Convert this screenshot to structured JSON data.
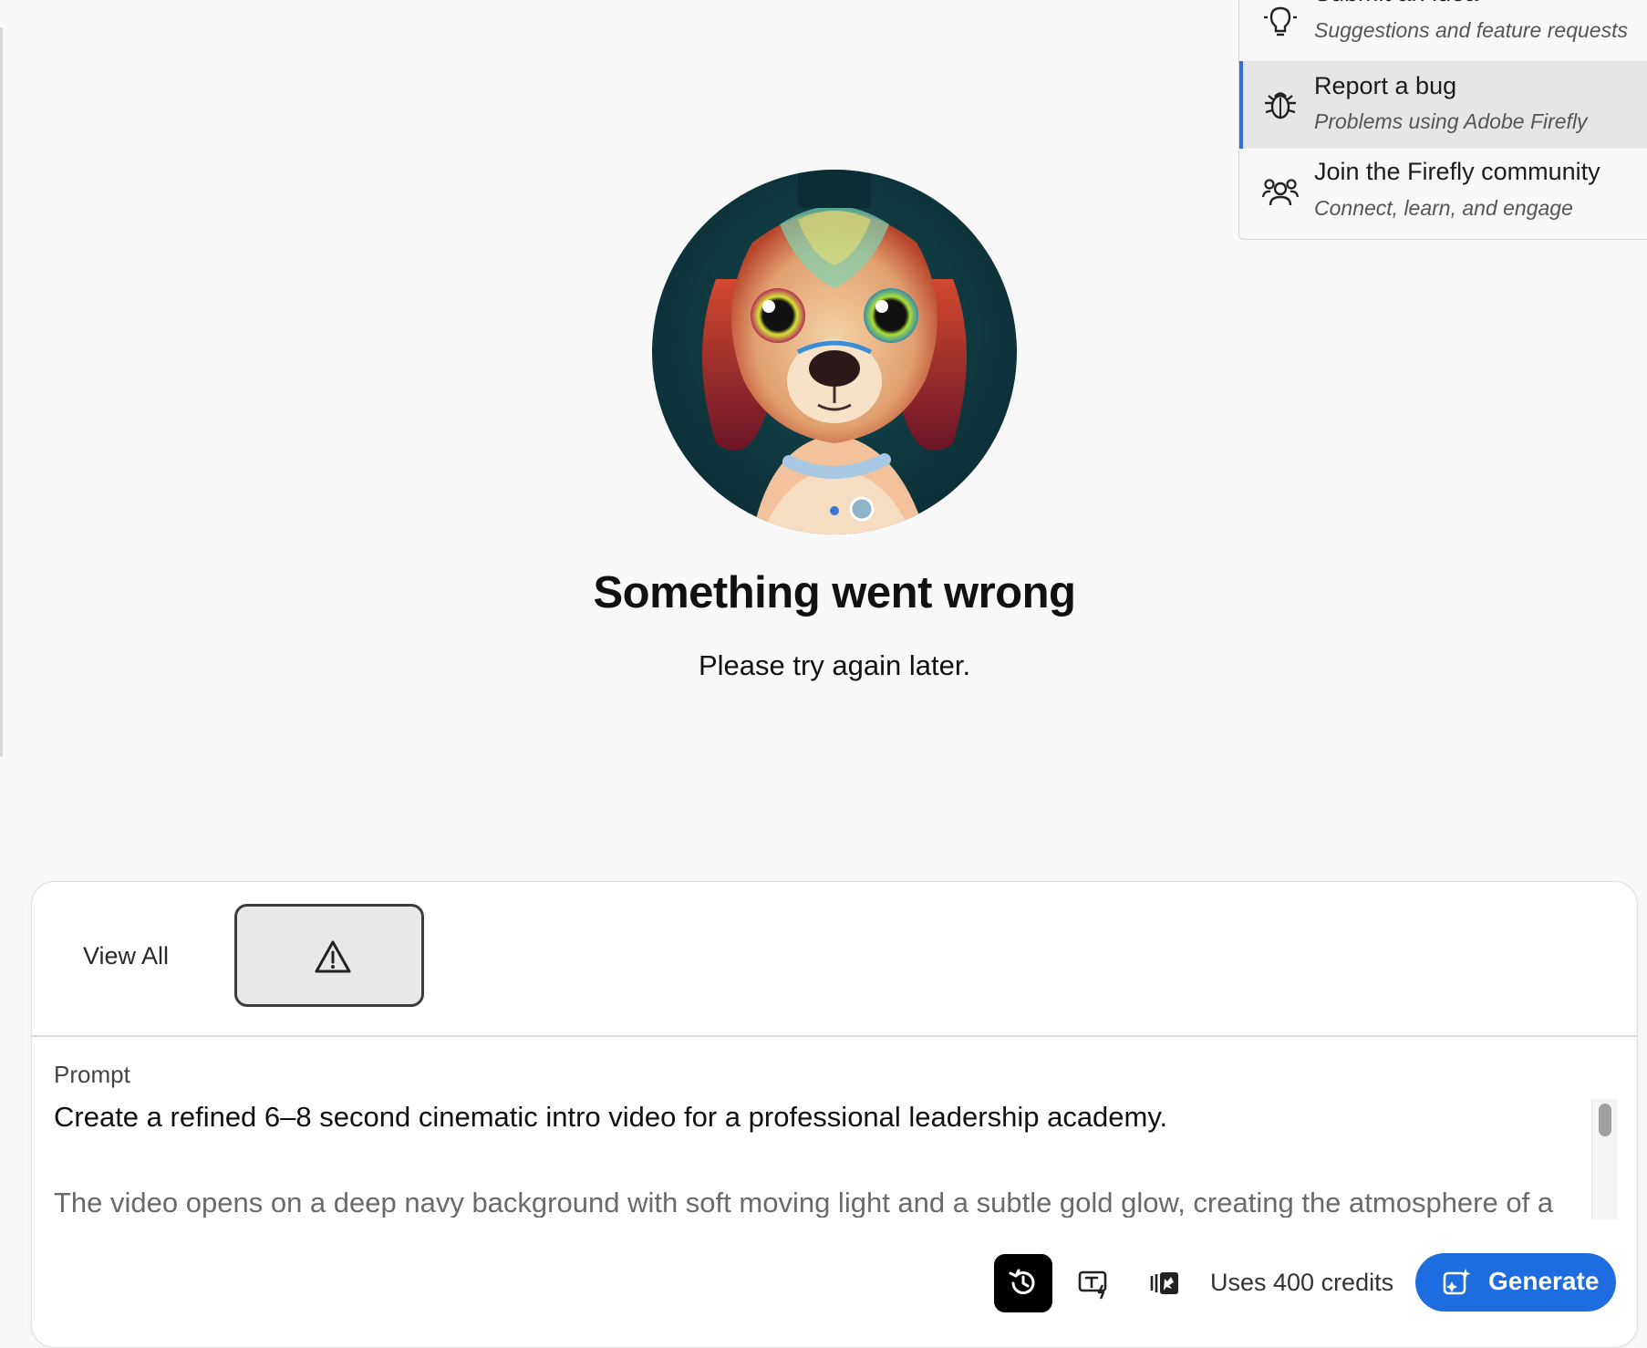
{
  "error": {
    "title": "Something went wrong",
    "message": "Please try again later."
  },
  "help_menu": {
    "items": [
      {
        "title": "Submit an idea",
        "description": "Suggestions and feature requests",
        "icon": "lightbulb-icon"
      },
      {
        "title": "Report a bug",
        "description": "Problems using Adobe Firefly",
        "icon": "bug-icon"
      },
      {
        "title": "Join the Firefly community",
        "description": "Connect, learn, and engage",
        "icon": "community-icon"
      }
    ]
  },
  "panel": {
    "view_all_label": "View All",
    "thumbnail_icon": "warning-icon",
    "prompt_label": "Prompt",
    "prompt_line1": "Create a refined 6–8 second cinematic intro video for a professional leadership academy.",
    "prompt_line2": "The video opens on a deep navy background with soft moving light and a subtle gold glow, creating the atmosphere of a",
    "credits_text": "Uses 400 credits",
    "generate_label": "Generate"
  },
  "colors": {
    "accent": "#1d6de0",
    "menu_highlight": "#e6e6e6",
    "background": "#f8f8f8"
  }
}
